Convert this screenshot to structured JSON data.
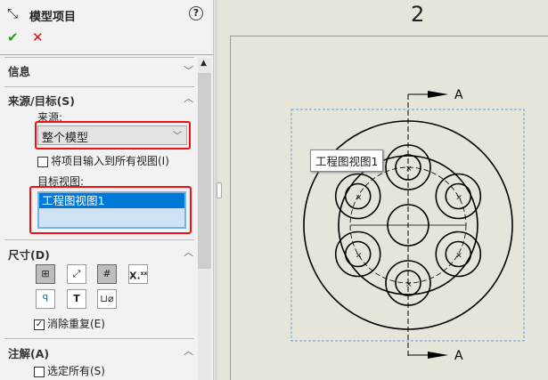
{
  "panel": {
    "title": "模型项目",
    "help": "?",
    "ok": "✔",
    "cancel": "✕",
    "sections": {
      "info": "信息",
      "source": "来源/目标(S)",
      "dims": "尺寸(D)",
      "annot": "注解(A)"
    },
    "source_label": "来源:",
    "source_value": "整个模型",
    "import_all": "将项目输入到所有视图(I)",
    "target_label": "目标视图:",
    "target_items": [
      "工程图视图1"
    ],
    "eliminate_dup": "消除重复(E)",
    "select_all": "选定所有(S)",
    "eliminate_dup_checked": true,
    "select_all_checked": false,
    "import_all_checked": false
  },
  "drawing": {
    "zone_label": "2",
    "view_tooltip": "工程图视图1",
    "section_label_top": "A",
    "section_label_bottom": "A"
  },
  "colors": {
    "highlight": "#f01010",
    "selection": "#0078d7",
    "list_bg": "#cfe3f6"
  }
}
